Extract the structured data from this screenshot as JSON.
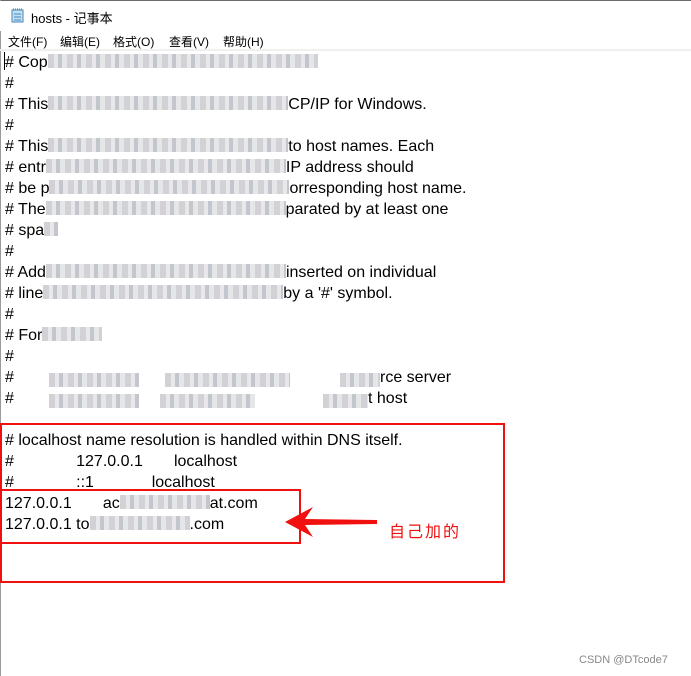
{
  "window": {
    "title": "hosts - 记事本",
    "app_icon": "notepad-icon"
  },
  "menu": [
    {
      "label": "文件(F)"
    },
    {
      "label": "编辑(E)"
    },
    {
      "label": "格式(O)"
    },
    {
      "label": "查看(V)"
    },
    {
      "label": "帮助(H)"
    }
  ],
  "editor": {
    "lines": [
      {
        "pre": "# Cop",
        "blurred": true,
        "post": ""
      },
      {
        "pre": "#",
        "blurred": false,
        "post": ""
      },
      {
        "pre": "# This",
        "blurred": true,
        "post": "CP/IP for Windows."
      },
      {
        "pre": "#",
        "blurred": false,
        "post": ""
      },
      {
        "pre": "# This",
        "blurred": true,
        "post": "to host names. Each"
      },
      {
        "pre": "# entr",
        "blurred": true,
        "post": "IP address should"
      },
      {
        "pre": "# be p",
        "blurred": true,
        "post": "orresponding host name."
      },
      {
        "pre": "# The",
        "blurred": true,
        "post": "parated by at least one"
      },
      {
        "pre": "# spa",
        "blurred": true,
        "post": ""
      },
      {
        "pre": "#",
        "blurred": false,
        "post": ""
      },
      {
        "pre": "# Add",
        "blurred": true,
        "post": "inserted on individual"
      },
      {
        "pre": "# line",
        "blurred": true,
        "post": "by a '#' symbol."
      },
      {
        "pre": "#",
        "blurred": false,
        "post": ""
      },
      {
        "pre": "# For",
        "blurred": true,
        "post": ""
      },
      {
        "pre": "#",
        "blurred": false,
        "post": ""
      },
      {
        "pre": "#",
        "blurred": true,
        "post": "rce server"
      },
      {
        "pre": "#",
        "blurred": true,
        "post": "t host"
      },
      {
        "pre": "",
        "blurred": false,
        "post": ""
      },
      {
        "pre": "# localhost name resolution is handled within DNS itself.",
        "blurred": false,
        "post": ""
      },
      {
        "pre": "#\t\t127.0.0.1       localhost",
        "blurred": false,
        "post": ""
      },
      {
        "pre": "#\t\t::1             localhost",
        "blurred": false,
        "post": ""
      },
      {
        "pre": "127.0.0.1       ac",
        "blurred": true,
        "post": "at.com"
      },
      {
        "pre": "127.0.0.1 to",
        "blurred": true,
        "post": ".com"
      }
    ]
  },
  "annotation": {
    "note": "自己加的",
    "color": "#f01010"
  },
  "watermark": "CSDN @DTcode7"
}
